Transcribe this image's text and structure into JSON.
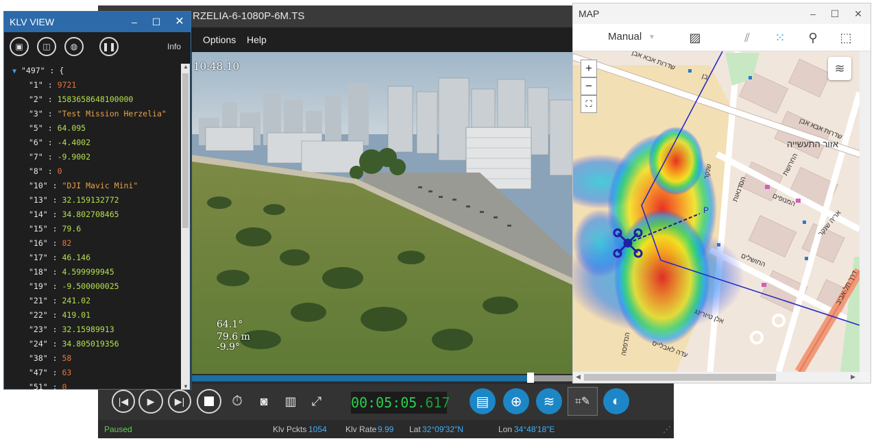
{
  "player": {
    "title": "RZELIA-6-1080P-6M.TS",
    "menu": {
      "options": "Options",
      "help": "Help"
    },
    "osd": {
      "clock": "10:48.10",
      "yaw": "64.1°",
      "altitude": "79.6 m",
      "pitch": "-9.9°"
    },
    "progress_fraction": 0.89,
    "timecode": {
      "main": "00:05:05",
      "ms": ".617"
    },
    "status": {
      "state": "Paused",
      "packets_label": "Klv Pckts",
      "packets_value": "1054",
      "rate_label": "Klv Rate",
      "rate_value": "9.99",
      "lat_label": "Lat",
      "lat_value": "32°09'32\"N",
      "lon_label": "Lon",
      "lon_value": "34°48'18\"E"
    }
  },
  "klv": {
    "title": "KLV VIEW",
    "info_label": "Info",
    "root_key": "\"497\" : {",
    "rows": [
      {
        "key": "\"1\"",
        "value": "9721",
        "kind": "red"
      },
      {
        "key": "\"2\"",
        "value": "1583658648100000",
        "kind": "num"
      },
      {
        "key": "\"3\"",
        "value": "\"Test Mission Herzelia\"",
        "kind": "str"
      },
      {
        "key": "\"5\"",
        "value": "64.095",
        "kind": "num"
      },
      {
        "key": "\"6\"",
        "value": "-4.4002",
        "kind": "num"
      },
      {
        "key": "\"7\"",
        "value": "-9.9002",
        "kind": "num"
      },
      {
        "key": "\"8\"",
        "value": "0",
        "kind": "red"
      },
      {
        "key": "\"10\"",
        "value": "\"DJI Mavic Mini\"",
        "kind": "str"
      },
      {
        "key": "\"13\"",
        "value": "32.159132772",
        "kind": "num"
      },
      {
        "key": "\"14\"",
        "value": "34.802708465",
        "kind": "num"
      },
      {
        "key": "\"15\"",
        "value": "79.6",
        "kind": "num"
      },
      {
        "key": "\"16\"",
        "value": "82",
        "kind": "red"
      },
      {
        "key": "\"17\"",
        "value": "46.146",
        "kind": "num"
      },
      {
        "key": "\"18\"",
        "value": "4.599999945",
        "kind": "num"
      },
      {
        "key": "\"19\"",
        "value": "-9.500000025",
        "kind": "num"
      },
      {
        "key": "\"21\"",
        "value": "241.02",
        "kind": "num"
      },
      {
        "key": "\"22\"",
        "value": "419.01",
        "kind": "num"
      },
      {
        "key": "\"23\"",
        "value": "32.15989913",
        "kind": "num"
      },
      {
        "key": "\"24\"",
        "value": "34.805019356",
        "kind": "num"
      },
      {
        "key": "\"38\"",
        "value": "58",
        "kind": "red"
      },
      {
        "key": "\"47\"",
        "value": "63",
        "kind": "red"
      },
      {
        "key": "\"51\"",
        "value": "0",
        "kind": "red"
      }
    ]
  },
  "map": {
    "title": "MAP",
    "mode": "Manual",
    "zoom_in": "+",
    "zoom_out": "−",
    "street_labels": [
      "שדרות אבא אבן",
      "בן",
      "אזור התעשייה",
      "שדרות אבא אבן",
      "הסדנאות",
      "החרושת",
      "המנופים",
      "אריה שנקר",
      "שנקר",
      "החושלים",
      "דרך תל-אביב",
      "אלן טיורינג",
      "עדה לאבלייס",
      "הנדפסה"
    ]
  },
  "icons": {
    "klv_toolbar": [
      "save-icon",
      "map-book-icon",
      "globe-icon",
      "pause-icon"
    ],
    "player_controls": [
      "skip-previous-icon",
      "play-icon",
      "skip-next-icon",
      "stop-icon",
      "timer-icon",
      "camera-icon",
      "bar-chart-icon",
      "fullscreen-icon"
    ],
    "player_tools": [
      "klv-list-icon",
      "globe-icon",
      "layers-icon",
      "grid-tools-icon",
      "sync-icon"
    ],
    "map_toolbar": [
      "image-icon",
      "hatch-icon",
      "dotted-grid-icon",
      "zoom-tool-icon",
      "fit-text-icon"
    ]
  },
  "colors": {
    "klv_title": "#2d6aaa",
    "progress": "#1c6fa3",
    "timecode": "#29d14a",
    "status_value": "#3fb0ff",
    "track_line": "#2828c8"
  }
}
